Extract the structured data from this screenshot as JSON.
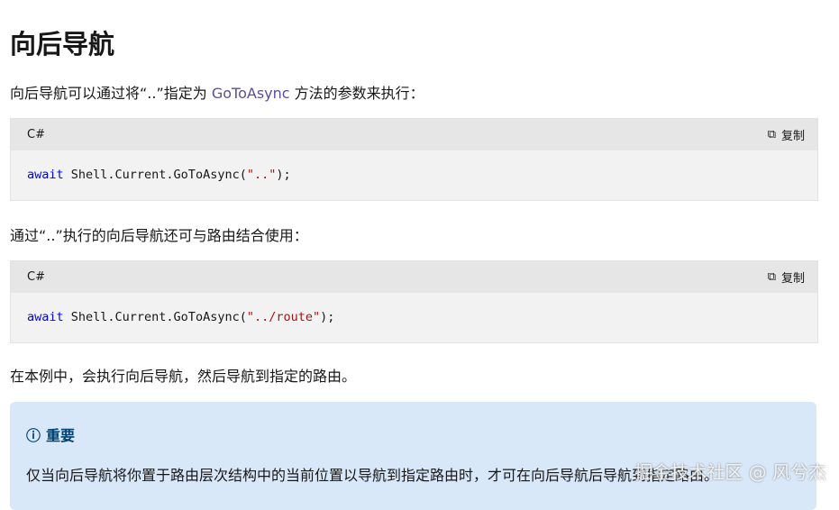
{
  "title": "向后导航",
  "p1": {
    "before": "向后导航可以通过将“..”指定为 ",
    "link": "GoToAsync",
    "after": " 方法的参数来执行："
  },
  "code1": {
    "lang": "C#",
    "copy": "复制",
    "kw": "await",
    "mid": " Shell.Current.GoToAsync(",
    "str": "\"..\"",
    "end": ");"
  },
  "p2": "通过“..”执行的向后导航还可与路由结合使用：",
  "code2": {
    "lang": "C#",
    "copy": "复制",
    "kw": "await",
    "mid": " Shell.Current.GoToAsync(",
    "str": "\"../route\"",
    "end": ");"
  },
  "p3": "在本例中，会执行向后导航，然后导航到指定的路由。",
  "note": {
    "icon": "info-icon",
    "title": "重要",
    "body": "仅当向后导航将你置于路由层次结构中的当前位置以导航到指定路由时，才可在向后导航后导航到指定路由。"
  },
  "watermark": "掘金技术社区 @ 风兮杰"
}
